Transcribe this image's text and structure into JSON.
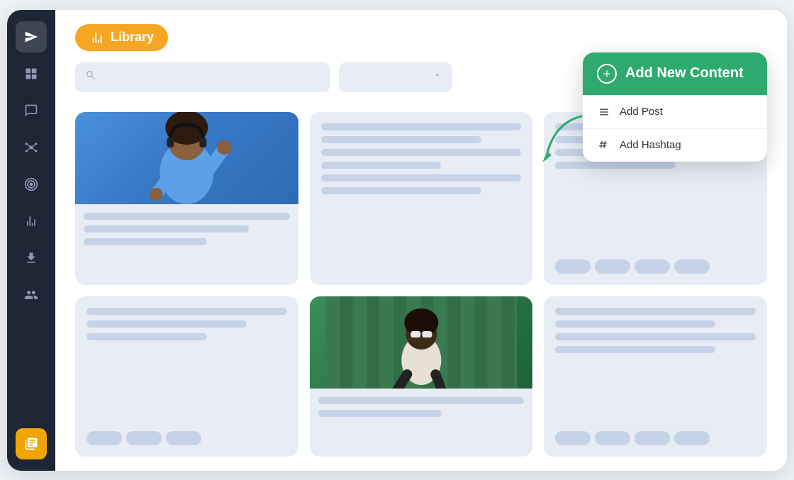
{
  "app": {
    "title": "Library"
  },
  "sidebar": {
    "items": [
      {
        "id": "send",
        "icon": "➤",
        "active": true,
        "label": "Send"
      },
      {
        "id": "dashboard",
        "icon": "⊞",
        "label": "Dashboard"
      },
      {
        "id": "messages",
        "icon": "💬",
        "label": "Messages"
      },
      {
        "id": "network",
        "icon": "⬡",
        "label": "Network"
      },
      {
        "id": "targets",
        "icon": "◎",
        "label": "Targets"
      },
      {
        "id": "analytics",
        "icon": "📊",
        "label": "Analytics"
      },
      {
        "id": "downloads",
        "icon": "⬇",
        "label": "Downloads"
      },
      {
        "id": "team",
        "icon": "👥",
        "label": "Team"
      }
    ],
    "active_bottom": {
      "id": "library",
      "icon": "📚",
      "label": "Library"
    }
  },
  "toolbar": {
    "search_placeholder": "",
    "filter_placeholder": "",
    "search_icon": "🔍",
    "chevron_icon": "▾"
  },
  "popup": {
    "header_label": "Add New Content",
    "header_icon": "+",
    "items": [
      {
        "id": "add-post",
        "icon": "≡",
        "label": "Add Post"
      },
      {
        "id": "add-hashtag",
        "icon": "#",
        "label": "Add Hashtag"
      }
    ]
  },
  "cards": [
    {
      "id": 1,
      "has_image": true,
      "image_type": "blue",
      "lines": [
        "full",
        "medium",
        "short"
      ],
      "has_tags": false
    },
    {
      "id": 2,
      "has_image": false,
      "image_type": null,
      "lines": [
        "full",
        "medium",
        "full",
        "short"
      ],
      "has_tags": false
    },
    {
      "id": 3,
      "has_image": false,
      "image_type": null,
      "lines": [
        "full",
        "medium",
        "short"
      ],
      "has_tags": true
    },
    {
      "id": 4,
      "has_image": false,
      "image_type": null,
      "lines": [
        "full",
        "medium",
        "short"
      ],
      "has_tags": true
    },
    {
      "id": 5,
      "has_image": true,
      "image_type": "green",
      "lines": [
        "full",
        "short"
      ],
      "has_tags": false
    },
    {
      "id": 6,
      "has_image": false,
      "image_type": null,
      "lines": [
        "full",
        "medium",
        "full"
      ],
      "has_tags": true
    }
  ]
}
